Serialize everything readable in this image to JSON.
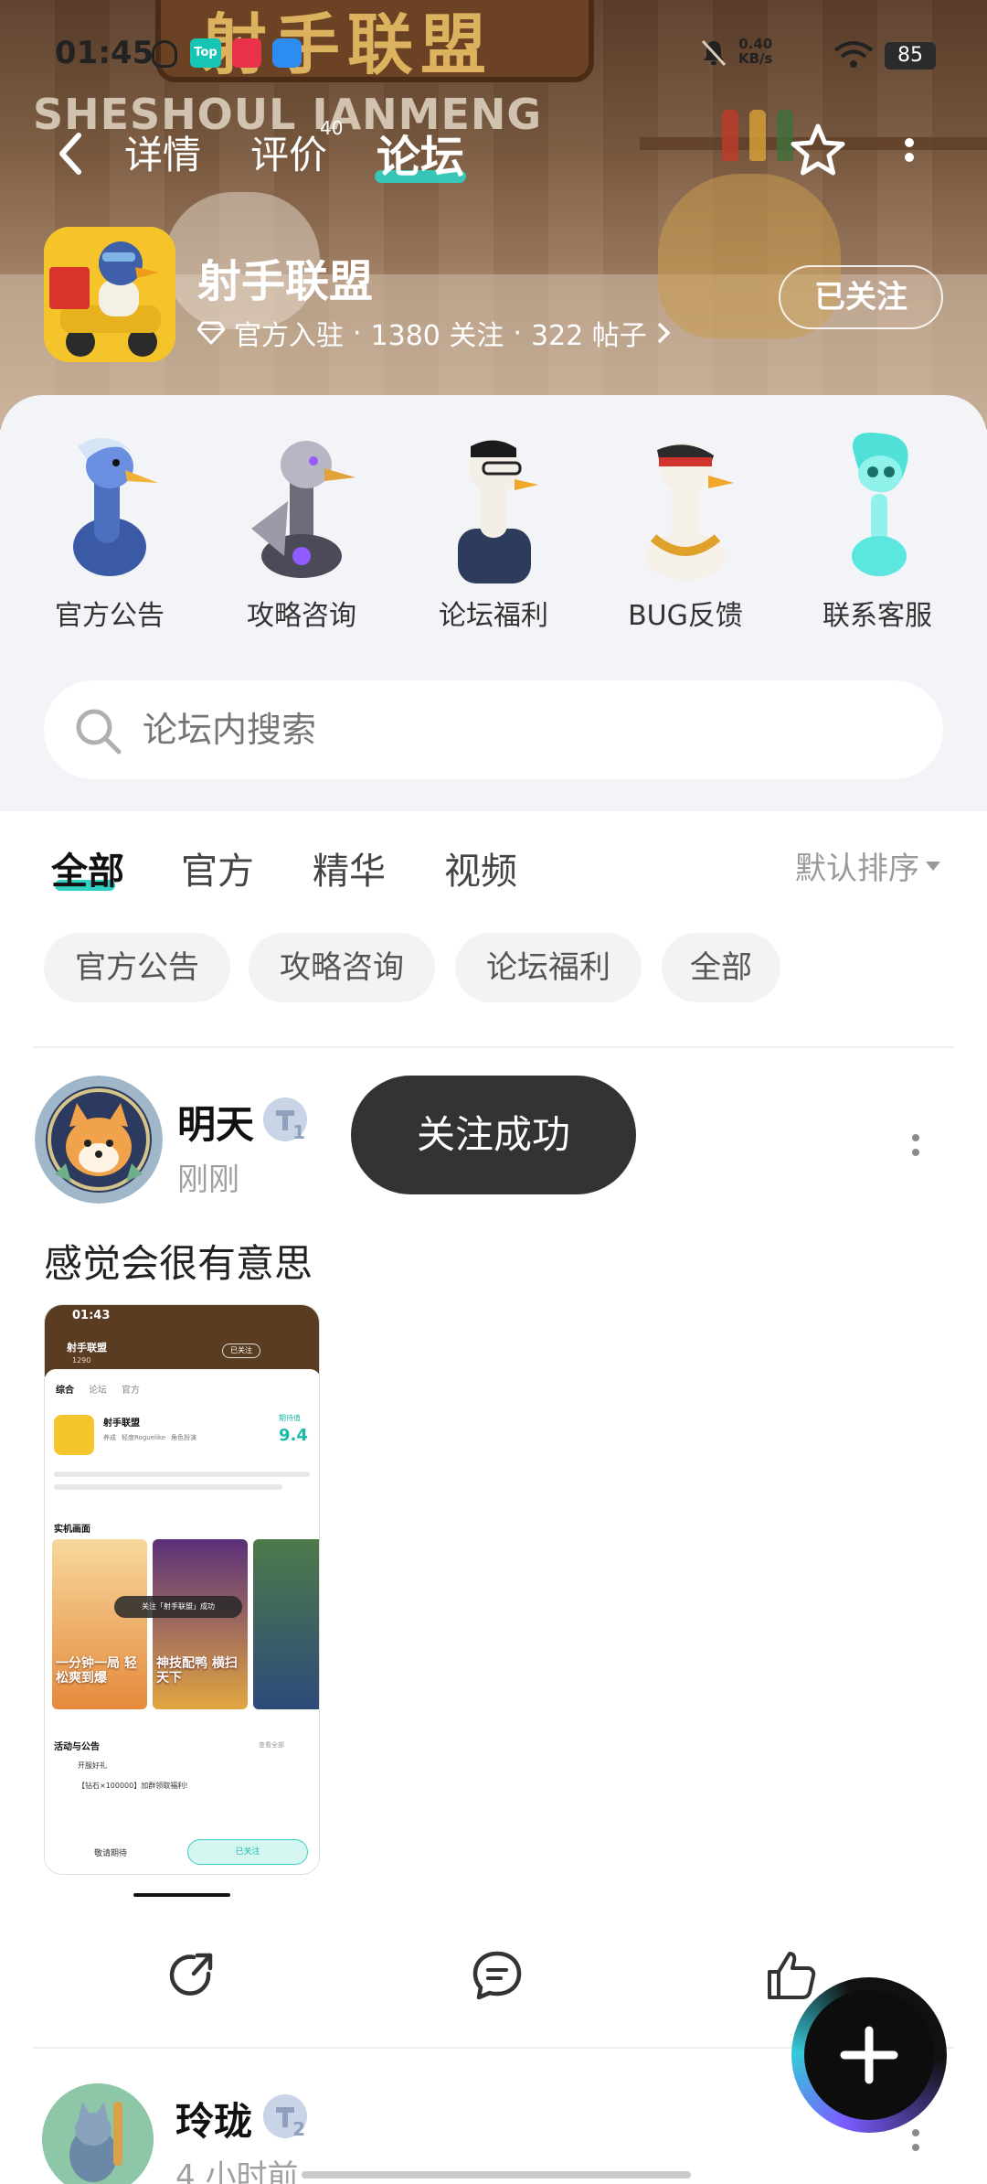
{
  "status_bar": {
    "time": "01:45",
    "net_speed_value": "0.40",
    "net_speed_unit": "KB/s",
    "battery": "85"
  },
  "nav": {
    "tabs": [
      {
        "label": "详情"
      },
      {
        "label": "评价",
        "badge": "40"
      },
      {
        "label": "论坛"
      }
    ],
    "active_tab": "论坛"
  },
  "banner": {
    "sign_text": "射手联盟",
    "sub_sign_text": "SHESHOUL IANMENG"
  },
  "game": {
    "title": "射手联盟",
    "meta_official": "官方入驻",
    "meta_follows": "1380 关注",
    "meta_posts": "322 帖子",
    "follow_label": "已关注"
  },
  "categories": [
    {
      "label": "官方公告"
    },
    {
      "label": "攻略咨询"
    },
    {
      "label": "论坛福利"
    },
    {
      "label": "BUG反馈"
    },
    {
      "label": "联系客服"
    }
  ],
  "search": {
    "placeholder": "论坛内搜索"
  },
  "filter_tabs": [
    {
      "label": "全部"
    },
    {
      "label": "官方"
    },
    {
      "label": "精华"
    },
    {
      "label": "视频"
    }
  ],
  "sort_label": "默认排序",
  "chips": [
    {
      "label": "官方公告"
    },
    {
      "label": "攻略咨询"
    },
    {
      "label": "论坛福利"
    },
    {
      "label": "全部"
    }
  ],
  "post": {
    "author": "明天",
    "level": "1",
    "time": "刚刚",
    "text": "感觉会很有意思",
    "screenshot": {
      "time": "01:43",
      "app_title": "射手联盟",
      "app_follows": "1290",
      "follow_btn": "已关注",
      "tabs": [
        "综合",
        "论坛",
        "官方"
      ],
      "game_name": "射手联盟",
      "tags": [
        "养成",
        "轻度Roguelike",
        "角色扮演"
      ],
      "rating_label": "期待值",
      "rating": "9.4",
      "section_title": "实机画面",
      "toast": "关注「射手联盟」成功",
      "promo1": "一分钟一局 轻松爽到爆",
      "promo2": "神技配鸭 横扫天下",
      "activity_title": "活动与公告",
      "activity_more": "查看全部",
      "activity1": "开服好礼",
      "activity2": "【钻石×100000】加群领取福利!",
      "bottom_left": "敬请期待",
      "bottom_right": "已关注"
    }
  },
  "toast": {
    "text": "关注成功"
  },
  "post2": {
    "author": "玲珑",
    "level": "2",
    "time": "4 小时前"
  },
  "colors": {
    "accent": "#30d1c2",
    "toast_bg": "#333333",
    "panel_bg": "#f2f4f7"
  }
}
